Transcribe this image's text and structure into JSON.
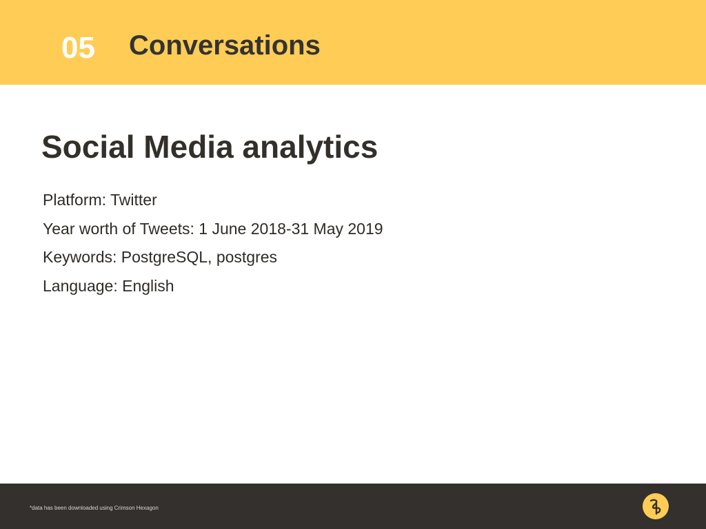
{
  "header": {
    "section_number": "05",
    "section_title": "Conversations"
  },
  "main": {
    "title": "Social Media analytics",
    "items": [
      "Platform: Twitter",
      "Year worth of Tweets: 1 June 2018-31 May 2019",
      "Keywords: PostgreSQL, postgres",
      "Language: English"
    ]
  },
  "footer": {
    "note": "*data has been downloaded using Crimson Hexagon",
    "logo_icon": "logo-icon"
  },
  "colors": {
    "accent": "#ffcc55",
    "footer_background": "#34302d",
    "text": "#33302b"
  }
}
